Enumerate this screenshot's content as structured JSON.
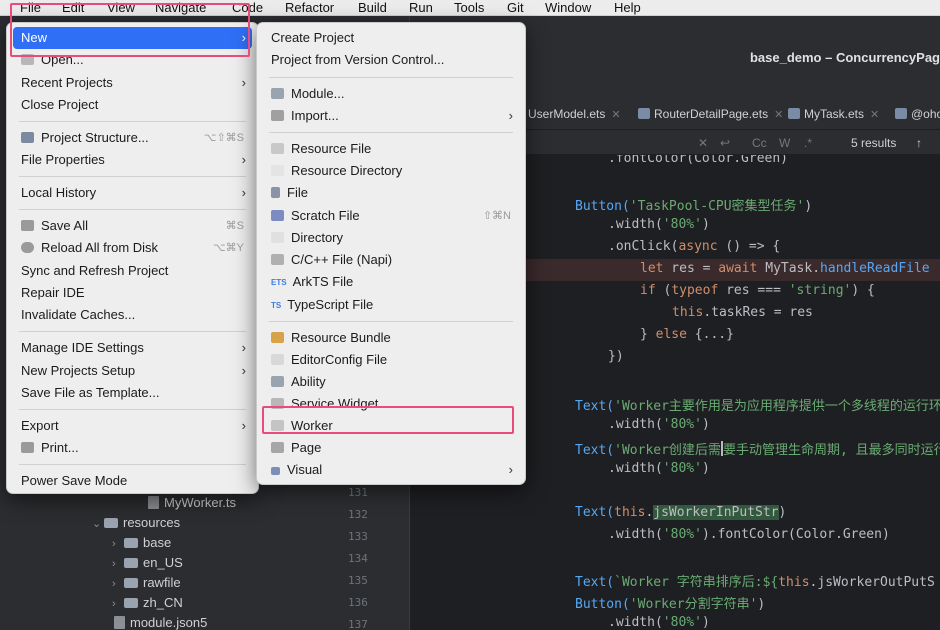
{
  "menubar": {
    "items": [
      "File",
      "Edit",
      "View",
      "Navigate",
      "Code",
      "Refactor",
      "Build",
      "Run",
      "Tools",
      "Git",
      "Window",
      "Help"
    ]
  },
  "ide": {
    "title": "base_demo – ConcurrencyPag",
    "tabs": [
      "UserModel.ets",
      "RouterDetailPage.ets",
      "MyTask.ets",
      "@oho"
    ],
    "find": {
      "cc": "Cc",
      "w": "W",
      "star": ".*",
      "results": "5 results",
      "up": "↑"
    }
  },
  "file_menu": {
    "items": [
      {
        "label": "New",
        "submenu": true,
        "active": true
      },
      {
        "label": "Open..."
      },
      {
        "label": "Recent Projects",
        "submenu": true
      },
      {
        "label": "Close Project"
      },
      {
        "label": "Project Structure...",
        "shortcut": "⌥⇧⌘S"
      },
      {
        "label": "File Properties",
        "submenu": true
      },
      {
        "label": "Local History",
        "submenu": true
      },
      {
        "label": "Save All",
        "shortcut": "⌘S"
      },
      {
        "label": "Reload All from Disk",
        "shortcut": "⌥⌘Y"
      },
      {
        "label": "Sync and Refresh Project"
      },
      {
        "label": "Repair IDE"
      },
      {
        "label": "Invalidate Caches..."
      },
      {
        "label": "Manage IDE Settings",
        "submenu": true
      },
      {
        "label": "New Projects Setup",
        "submenu": true
      },
      {
        "label": "Save File as Template..."
      },
      {
        "label": "Export",
        "submenu": true
      },
      {
        "label": "Print..."
      },
      {
        "label": "Power Save Mode"
      }
    ]
  },
  "new_menu": {
    "items": [
      {
        "label": "Create Project"
      },
      {
        "label": "Project from Version Control..."
      },
      {
        "label": "Module..."
      },
      {
        "label": "Import...",
        "submenu": true
      },
      {
        "label": "Resource File"
      },
      {
        "label": "Resource Directory"
      },
      {
        "label": "File"
      },
      {
        "label": "Scratch File",
        "shortcut": "⇧⌘N"
      },
      {
        "label": "Directory"
      },
      {
        "label": "C/C++ File (Napi)"
      },
      {
        "label": "ArkTS File"
      },
      {
        "label": "TypeScript File"
      },
      {
        "label": "Resource Bundle"
      },
      {
        "label": "EditorConfig File"
      },
      {
        "label": "Ability"
      },
      {
        "label": "Service Widget"
      },
      {
        "label": "Worker"
      },
      {
        "label": "Page"
      },
      {
        "label": "Visual",
        "submenu": true
      }
    ],
    "icon_text": {
      "ets": "ETS",
      "ts": "TS"
    }
  },
  "project_tree": [
    {
      "label": "MyWorker.ts"
    },
    {
      "label": "resources"
    },
    {
      "label": "base"
    },
    {
      "label": "en_US"
    },
    {
      "label": "rawfile"
    },
    {
      "label": "zh_CN"
    },
    {
      "label": "module.json5"
    }
  ],
  "line_numbers": [
    "131",
    "132",
    "133",
    "134",
    "135",
    "136",
    "137"
  ],
  "code": {
    "l0": ".fontColor(Color.Green)",
    "l1a": "Button(",
    "l1b": "'TaskPool-CPU密集型任务'",
    "l1c": ")",
    "l2a": ".width(",
    "l2b": "'80%'",
    "l2c": ")",
    "l3a": ".onClick(",
    "l3b": "async",
    "l3c": " () => {",
    "l4a": "let",
    "l4b": " res = ",
    "l4c": "await",
    "l4d": " MyTask.",
    "l4e": "handleReadFile",
    "l5a": "if",
    "l5b": " (",
    "l5c": "typeof",
    "l5d": " res === ",
    "l5e": "'string'",
    "l5f": ") {",
    "l6a": "this",
    "l6b": ".taskRes = res",
    "l7a": "} ",
    "l7b": "else",
    "l7c": " {...}",
    "l8": "})",
    "l9a": "Text(",
    "l9b": "'Worker主要作用是为应用程序提供一个多线程的运行环",
    "l10a": ".width(",
    "l10b": "'80%'",
    "l10c": ")",
    "l11a": "Text(",
    "l11b": "'Worker创建后需",
    "l11c": "要手动管理生命周期, 且最多同时运行",
    "l12a": ".width(",
    "l12b": "'80%'",
    "l12c": ")",
    "l13a": "Text(",
    "l13b": "this",
    "l13c": ".",
    "l13d": "jsWorkerInPutStr",
    "l13e": ")",
    "l14a": ".width(",
    "l14b": "'80%'",
    "l14c": ").fontColor(Color.Green)",
    "l15a": "Text(",
    "l15b": "`Worker 字符串排序后:${",
    "l15c": "this",
    "l15d": ".jsWorkerOutPutS",
    "l16a": "Button(",
    "l16b": "'Worker分割字符串'",
    "l16c": ")",
    "l17a": ".width(",
    "l17b": "'80%'",
    "l17c": ")"
  },
  "colors": {
    "accent": "#2f6ff5",
    "highlight_box": "#e94b7a"
  }
}
